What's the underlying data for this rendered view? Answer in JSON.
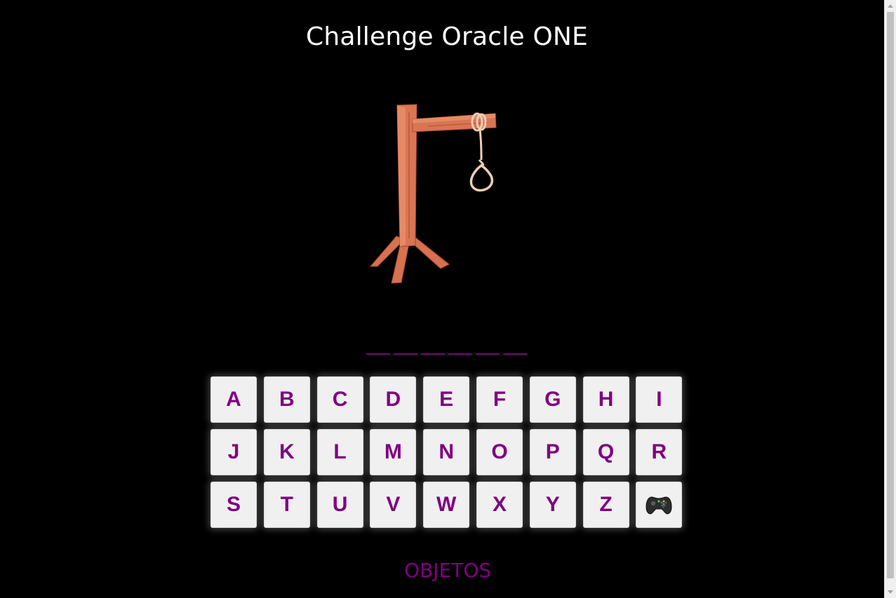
{
  "header": {
    "title": "Challenge Oracle ONE"
  },
  "gallows": {
    "icon": "gallows-noose-icon"
  },
  "word": {
    "letters": [
      "",
      "",
      "",
      "",
      "",
      ""
    ]
  },
  "keyboard": {
    "keys": [
      "A",
      "B",
      "C",
      "D",
      "E",
      "F",
      "G",
      "H",
      "I",
      "J",
      "K",
      "L",
      "M",
      "N",
      "O",
      "P",
      "Q",
      "R",
      "S",
      "T",
      "U",
      "V",
      "W",
      "X",
      "Y",
      "Z"
    ],
    "extra_icon": "gamepad-icon"
  },
  "category": {
    "label": "OBJETOS"
  },
  "colors": {
    "accent": "#800080",
    "background": "#000000",
    "key_bg": "#f0f0f0",
    "title": "#ffffff"
  }
}
